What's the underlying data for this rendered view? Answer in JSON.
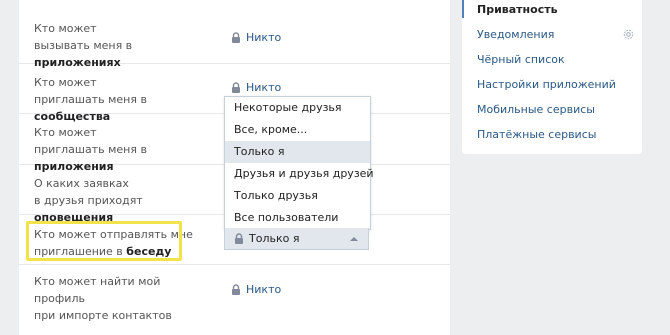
{
  "settings_rows": [
    {
      "label_line1": "Кто может",
      "label_line2_prefix": "вызывать меня в ",
      "label_line2_bold": "приложениях",
      "value": "Никто"
    },
    {
      "label_line1": "Кто может",
      "label_line2_prefix": "приглашать меня в ",
      "label_line2_bold": "сообщества",
      "value": "Никто"
    },
    {
      "label_line1": "Кто может",
      "label_line2_prefix": "приглашать меня в ",
      "label_line2_bold": "приложения"
    },
    {
      "label_line1": "О каких заявках",
      "label_line2_prefix": "в друзья приходят ",
      "label_line2_bold": "оповещения"
    },
    {
      "label_line1": "Кто может отправлять мне",
      "label_line2_prefix": "приглашение в ",
      "label_line2_bold": "беседу"
    },
    {
      "label_line1": "Кто может найти мой профиль",
      "label_line2_prefix": "при импорте контактов",
      "label_line2_bold": "",
      "value": "Никто"
    }
  ],
  "dropdown": {
    "options": [
      "Некоторые друзья",
      "Все, кроме...",
      "Только я",
      "Друзья и друзья друзей",
      "Только друзья",
      "Все пользователи"
    ],
    "highlighted_index": 2,
    "selected_value": "Только я"
  },
  "sidebar": {
    "items": [
      {
        "label": "Приватность",
        "current": true
      },
      {
        "label": "Уведомления"
      },
      {
        "label": "Чёрный список"
      },
      {
        "label": "Настройки приложений"
      },
      {
        "label": "Мобильные сервисы"
      },
      {
        "label": "Платёжные сервисы"
      }
    ]
  },
  "icons": {
    "lock": "lock-icon",
    "gear": "gear-icon",
    "caret": "caret-up-icon"
  },
  "colors": {
    "link": "#2a5885",
    "highlight_border": "#f2e34b",
    "dropdown_active_bg": "#e1e7ed",
    "page_bg": "#edeef0",
    "accent": "#5181b8"
  }
}
